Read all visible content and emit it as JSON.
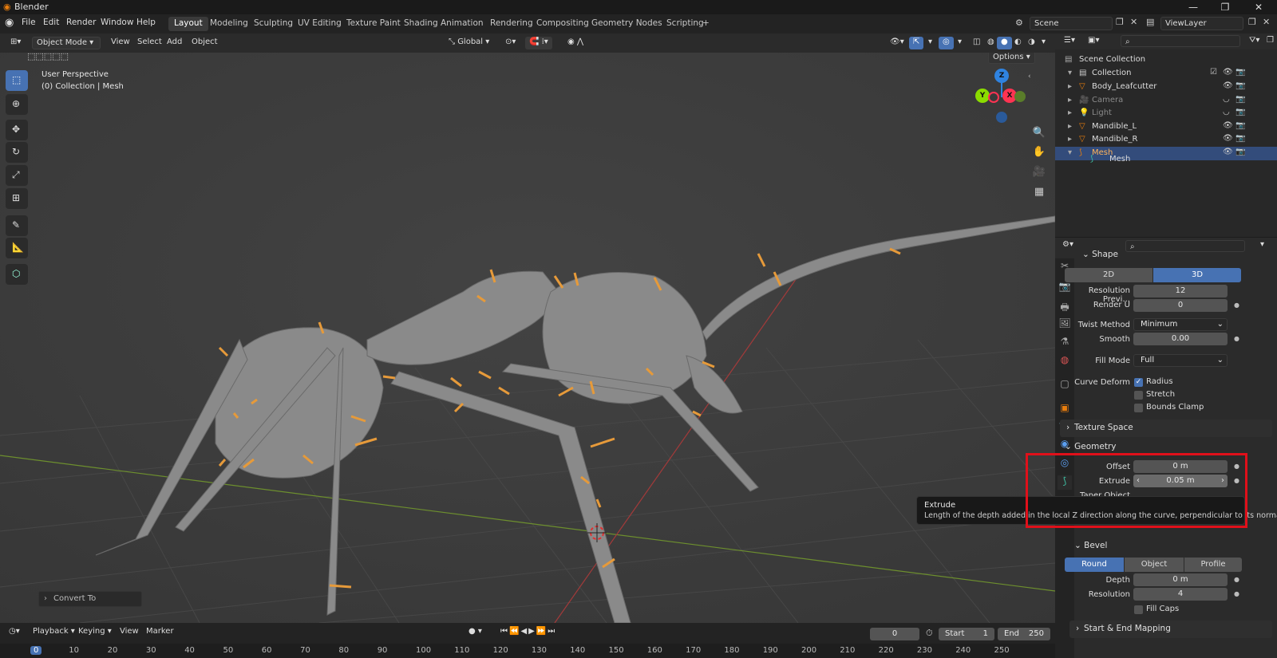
{
  "window": {
    "title": "Blender",
    "controls": [
      "—",
      "❐",
      "✕"
    ]
  },
  "menu": [
    "File",
    "Edit",
    "Render",
    "Window",
    "Help"
  ],
  "workspaces": [
    "Layout",
    "Modeling",
    "Sculpting",
    "UV Editing",
    "Texture Paint",
    "Shading",
    "Animation",
    "Rendering",
    "Compositing",
    "Geometry Nodes",
    "Scripting",
    "+"
  ],
  "scene": {
    "label": "Scene",
    "view_layer": "ViewLayer"
  },
  "viewport_header": {
    "mode": "Object Mode",
    "menus": [
      "View",
      "Select",
      "Add",
      "Object"
    ],
    "transform": "Global",
    "options": "Options"
  },
  "viewport": {
    "perspective": "User Perspective",
    "collection": "(0) Collection | Mesh",
    "convert_panel": "Convert To",
    "gizmo": {
      "z": "Z",
      "y": "Y",
      "x": "X",
      "x_color": "#ff3352",
      "y_color": "#8bdc00",
      "z_color": "#2f83e0"
    }
  },
  "outliner": {
    "root": "Scene Collection",
    "collection": "Collection",
    "items": [
      {
        "name": "Body_Leafcutter",
        "dim": false,
        "selected": false
      },
      {
        "name": "Camera",
        "dim": true,
        "selected": false
      },
      {
        "name": "Light",
        "dim": true,
        "selected": false
      },
      {
        "name": "Mandible_L",
        "dim": false,
        "selected": false
      },
      {
        "name": "Mandible_R",
        "dim": false,
        "selected": false
      },
      {
        "name": "Mesh",
        "dim": false,
        "selected": true
      }
    ],
    "child": "Mesh"
  },
  "properties": {
    "shape": {
      "title": "Shape",
      "dim2": "2D",
      "dim3": "3D",
      "resolution_preview_label": "Resolution Previ...",
      "resolution_preview": "12",
      "render_u_label": "Render U",
      "render_u": "0",
      "twist_method_label": "Twist Method",
      "twist_method": "Minimum",
      "smooth_label": "Smooth",
      "smooth": "0.00",
      "fill_mode_label": "Fill Mode",
      "fill_mode": "Full",
      "curve_deform_label": "Curve Deform",
      "radius": "Radius",
      "stretch": "Stretch",
      "bounds_clamp": "Bounds Clamp"
    },
    "texture_space": "Texture Space",
    "geometry": {
      "title": "Geometry",
      "offset_label": "Offset",
      "offset": "0 m",
      "extrude_label": "Extrude",
      "extrude": "0.05 m",
      "taper_label": "Taper Object"
    },
    "bevel": {
      "title": "Bevel",
      "round": "Round",
      "object": "Object",
      "profile": "Profile",
      "depth_label": "Depth",
      "depth": "0 m",
      "resolution_label": "Resolution",
      "resolution": "4",
      "fill_caps": "Fill Caps"
    },
    "start_end": "Start & End Mapping"
  },
  "tooltip": {
    "title": "Extrude",
    "text": "Length of the depth added in the local Z direction along the curve, perpendicular to its normals."
  },
  "timeline": {
    "menus": [
      "Playback",
      "Keying",
      "View",
      "Marker"
    ],
    "current_frame": "0",
    "start_label": "Start",
    "start": "1",
    "end_label": "End",
    "end": "250",
    "ruler": [
      "0",
      "10",
      "20",
      "30",
      "40",
      "50",
      "60",
      "70",
      "80",
      "90",
      "100",
      "110",
      "120",
      "130",
      "140",
      "150",
      "160",
      "170",
      "180",
      "190",
      "200",
      "210",
      "220",
      "230",
      "240",
      "250"
    ]
  }
}
